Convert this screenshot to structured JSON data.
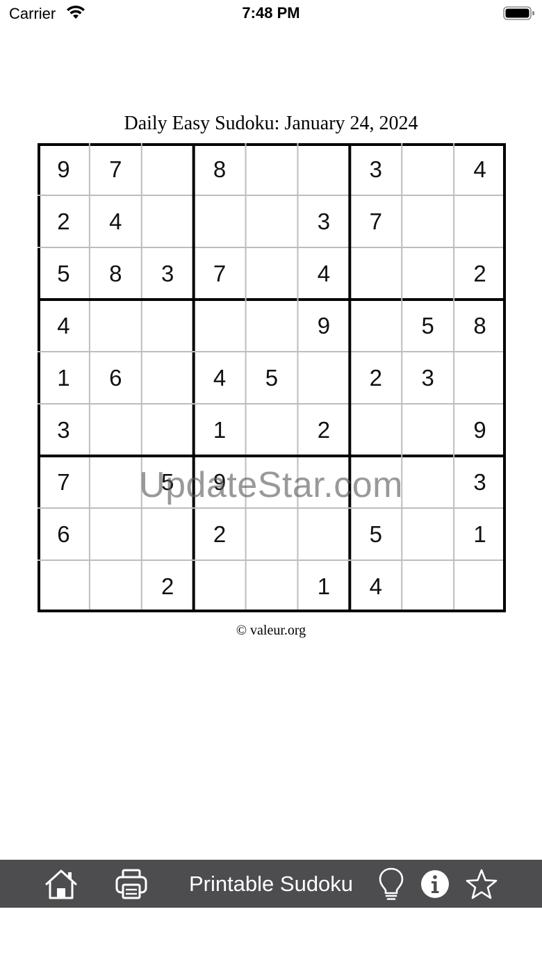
{
  "status_bar": {
    "carrier": "Carrier",
    "time": "7:48 PM"
  },
  "puzzle": {
    "title": "Daily Easy Sudoku: January 24, 2024",
    "copyright": "© valeur.org",
    "grid": [
      [
        "9",
        "7",
        "",
        "8",
        "",
        "",
        "3",
        "",
        "4"
      ],
      [
        "2",
        "4",
        "",
        "",
        "",
        "3",
        "7",
        "",
        ""
      ],
      [
        "5",
        "8",
        "3",
        "7",
        "",
        "4",
        "",
        "",
        "2"
      ],
      [
        "4",
        "",
        "",
        "",
        "",
        "9",
        "",
        "5",
        "8"
      ],
      [
        "1",
        "6",
        "",
        "4",
        "5",
        "",
        "2",
        "3",
        ""
      ],
      [
        "3",
        "",
        "",
        "1",
        "",
        "2",
        "",
        "",
        "9"
      ],
      [
        "7",
        "",
        "5",
        "9",
        "",
        "",
        "",
        "",
        "3"
      ],
      [
        "6",
        "",
        "",
        "2",
        "",
        "",
        "5",
        "",
        "1"
      ],
      [
        "",
        "",
        "2",
        "",
        "",
        "1",
        "4",
        "",
        ""
      ]
    ]
  },
  "watermark": "UpdateStar.com",
  "toolbar": {
    "title": "Printable Sudoku",
    "icons": [
      "home-icon",
      "printer-icon",
      "lightbulb-icon",
      "info-icon",
      "star-icon"
    ],
    "background": "#4d4d4f",
    "icon_color": "#ffffff"
  }
}
